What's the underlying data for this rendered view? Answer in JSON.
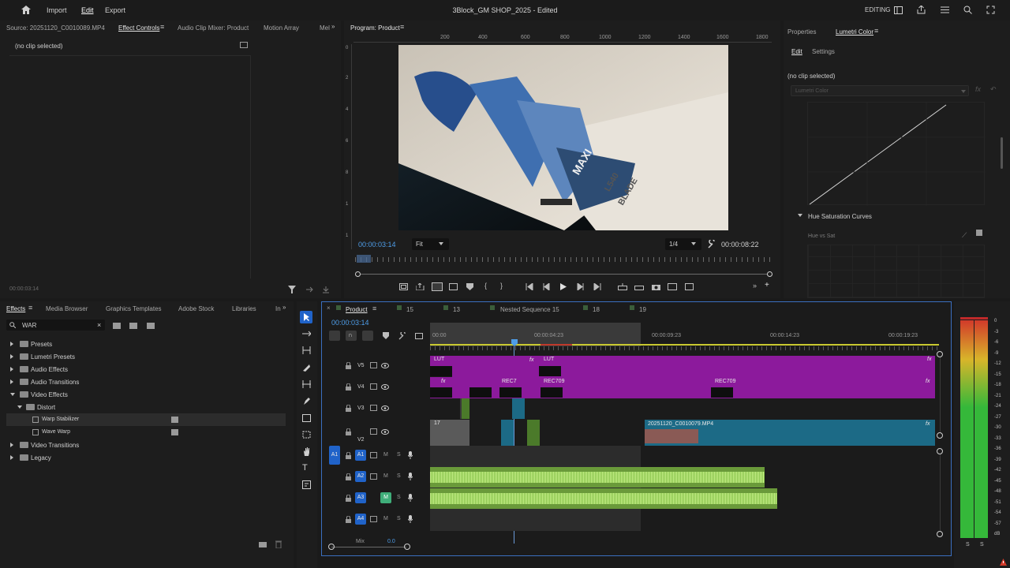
{
  "topbar": {
    "menu": [
      "Import",
      "Edit",
      "Export"
    ],
    "title": "3Block_GM SHOP_2025",
    "title_suffix": " - Edited",
    "workspace": "EDITING"
  },
  "source_panel": {
    "tabs": [
      "Source: 20251120_C0010089.MP4",
      "Effect Controls",
      "Audio Clip Mixer: Product",
      "Motion Array",
      "Mel"
    ],
    "no_clip": "(no clip selected)",
    "timecode": "00:00:03:14"
  },
  "program": {
    "tab": "Program: Product",
    "ruler": [
      "200",
      "400",
      "600",
      "800",
      "1000",
      "1200",
      "1400",
      "1600",
      "1800",
      "2000"
    ],
    "vruler": [
      "0",
      "2",
      "4",
      "6",
      "8",
      "1",
      "1",
      "1",
      "1",
      "1"
    ],
    "timecode": "00:00:03:14",
    "fit": "Fit",
    "quality": "1/4",
    "duration": "00:00:08:22",
    "frame_text": [
      "MAXI",
      "L540",
      "BLADE"
    ]
  },
  "lumetri": {
    "tabs": [
      "Properties",
      "Lumetri Color"
    ],
    "subtabs": [
      "Edit",
      "Settings"
    ],
    "no_clip": "(no clip selected)",
    "dropdown": "Lumetri Color",
    "section": "Hue Saturation Curves",
    "subsection": "Hue vs Sat"
  },
  "effects": {
    "tabs": [
      "Effects",
      "Media Browser",
      "Graphics Templates",
      "Adobe Stock",
      "Libraries",
      "In"
    ],
    "search": "WAR",
    "tree": [
      {
        "label": "Presets"
      },
      {
        "label": "Lumetri Presets"
      },
      {
        "label": "Audio Effects"
      },
      {
        "label": "Audio Transitions"
      },
      {
        "label": "Video Effects"
      },
      {
        "label": "Distort"
      },
      {
        "label": "Warp Stabilizer"
      },
      {
        "label": "Wave Warp"
      },
      {
        "label": "Video Transitions"
      },
      {
        "label": "Legacy"
      }
    ]
  },
  "timeline": {
    "tabs": [
      "Product",
      "15",
      "13",
      "Nested Sequence 15",
      "18",
      "19"
    ],
    "timecode": "00:00:03:14",
    "ruler": [
      "00:00",
      "00:00:04:23",
      "00:00:09:23",
      "00:00:14:23",
      "00:00:19:23"
    ],
    "video_tracks": [
      "V5",
      "V4",
      "V3",
      "V2"
    ],
    "audio_tracks": [
      "A1",
      "A2",
      "A3",
      "A4"
    ],
    "mix": "Mix",
    "mix_value": "0.0",
    "clips": {
      "lut1": "LUT",
      "lut2": "LUT",
      "rec1": "REC709",
      "rec2": "REC709",
      "rec3": "REC7",
      "v2num": "17",
      "v2clip": "20251120_C0010079.MP4",
      "fx": "fx"
    },
    "ms": [
      "M",
      "S"
    ]
  },
  "meter": {
    "scale": [
      "0",
      "-3",
      "-6",
      "-9",
      "-12",
      "-15",
      "-18",
      "-21",
      "-24",
      "-27",
      "-30",
      "-33",
      "-36",
      "-39",
      "-42",
      "-45",
      "-48",
      "-51",
      "-54",
      "-57",
      "dB"
    ],
    "solo": [
      "S",
      "S"
    ]
  }
}
